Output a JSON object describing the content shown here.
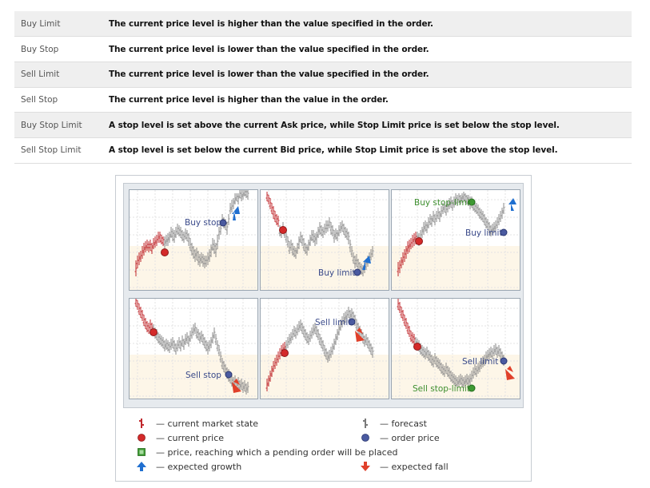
{
  "table": {
    "rows": [
      {
        "type": "Buy Limit",
        "desc": "The current price level is higher than the value specified in the order."
      },
      {
        "type": "Buy Stop",
        "desc": "The current price level is lower than the value specified in the order."
      },
      {
        "type": "Sell Limit",
        "desc": "The current price level is lower than the value specified in the order."
      },
      {
        "type": "Sell Stop",
        "desc": "The current price level is higher than the value in the order."
      },
      {
        "type": "Buy Stop Limit",
        "desc": "A stop level is set above the current Ask price, while Stop Limit price is set below the stop level."
      },
      {
        "type": "Sell Stop Limit",
        "desc": "A stop level is set below the current Bid price, while Stop Limit price is set above the stop level."
      }
    ]
  },
  "figure": {
    "panels": [
      {
        "labels": [
          "Buy stop"
        ]
      },
      {
        "labels": [
          "Buy limit"
        ]
      },
      {
        "labels": [
          "Buy stop-limit",
          "Buy limit"
        ]
      },
      {
        "labels": [
          "Sell stop"
        ]
      },
      {
        "labels": [
          "Sell limit"
        ]
      },
      {
        "labels": [
          "Sell limit",
          "Sell stop-limit"
        ]
      }
    ],
    "legend": {
      "current_market_state": "— current market state",
      "forecast": "— forecast",
      "current_price": "— current price",
      "order_price": "— order price",
      "price_reaching": "— price, reaching which a pending order will be placed",
      "expected_growth": "— expected growth",
      "expected_fall": "— expected fall"
    },
    "colors": {
      "market": "#c0282d",
      "forecast": "#7a7a7a",
      "current_price": "#d42a2a",
      "order_price": "#4a5aa0",
      "stop_limit": "#3e9a33",
      "growth": "#1f6fd0",
      "fall": "#e0402a"
    }
  }
}
